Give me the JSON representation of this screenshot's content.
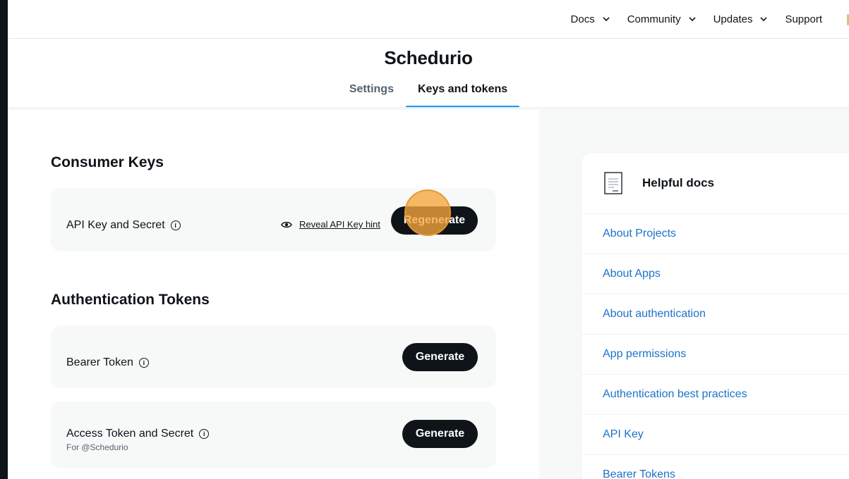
{
  "nav": {
    "items": [
      {
        "label": "Docs",
        "dropdown": true
      },
      {
        "label": "Community",
        "dropdown": true
      },
      {
        "label": "Updates",
        "dropdown": true
      },
      {
        "label": "Support",
        "dropdown": false
      }
    ]
  },
  "app": {
    "title": "Schedurio",
    "tabs": [
      {
        "label": "Settings",
        "active": false
      },
      {
        "label": "Keys and tokens",
        "active": true
      }
    ]
  },
  "consumer_keys": {
    "title": "Consumer Keys",
    "api_key": {
      "label": "API Key and Secret",
      "reveal_label": "Reveal API Key hint",
      "button_label": "Regenerate"
    }
  },
  "auth_tokens": {
    "title": "Authentication Tokens",
    "bearer": {
      "label": "Bearer Token",
      "button_label": "Generate"
    },
    "access": {
      "label": "Access Token and Secret",
      "sub": "For @Schedurio",
      "button_label": "Generate"
    }
  },
  "helpful_docs": {
    "title": "Helpful docs",
    "links": [
      "About Projects",
      "About Apps",
      "About authentication",
      "App permissions",
      "Authentication best practices",
      "API Key",
      "Bearer Tokens"
    ]
  },
  "colors": {
    "accent": "#1d9bf0",
    "link": "#1a73c8",
    "button": "#0f1419",
    "click_indicator": "#f5a63c"
  }
}
